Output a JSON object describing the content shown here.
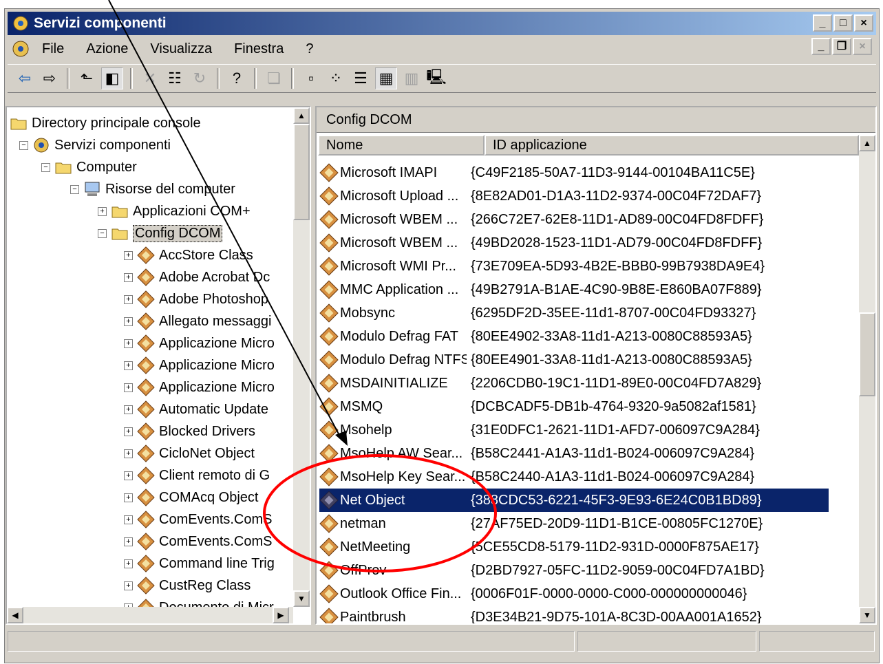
{
  "window": {
    "title": "Servizi componenti"
  },
  "menu": [
    "File",
    "Azione",
    "Visualizza",
    "Finestra",
    "?"
  ],
  "tree": [
    {
      "label": "Directory principale console",
      "icon": "folder-icon",
      "level": 0,
      "expander": ""
    },
    {
      "label": "Servizi componenti",
      "icon": "component-services-icon",
      "level": 1,
      "expander": "−"
    },
    {
      "label": "Computer",
      "icon": "folder-icon",
      "level": 2,
      "expander": "−"
    },
    {
      "label": "Risorse del computer",
      "icon": "computer-icon",
      "level": 3,
      "expander": "−"
    },
    {
      "label": "Applicazioni COM+",
      "icon": "folder-icon",
      "level": 4,
      "expander": "+"
    },
    {
      "label": "Config DCOM",
      "icon": "open-folder-icon",
      "level": 4,
      "expander": "−",
      "selected": true
    },
    {
      "label": "AccStore Class",
      "icon": "component-icon",
      "level": 5,
      "expander": "+"
    },
    {
      "label": "Adobe Acrobat Dc",
      "icon": "component-icon",
      "level": 5,
      "expander": "+"
    },
    {
      "label": "Adobe Photoshop",
      "icon": "component-icon",
      "level": 5,
      "expander": "+"
    },
    {
      "label": "Allegato messaggi",
      "icon": "component-icon",
      "level": 5,
      "expander": "+"
    },
    {
      "label": "Applicazione Micro",
      "icon": "component-icon",
      "level": 5,
      "expander": "+"
    },
    {
      "label": "Applicazione Micro",
      "icon": "component-icon",
      "level": 5,
      "expander": "+"
    },
    {
      "label": "Applicazione Micro",
      "icon": "component-icon",
      "level": 5,
      "expander": "+"
    },
    {
      "label": "Automatic Update",
      "icon": "component-icon",
      "level": 5,
      "expander": "+"
    },
    {
      "label": "Blocked Drivers",
      "icon": "component-icon",
      "level": 5,
      "expander": "+"
    },
    {
      "label": "CicloNet Object",
      "icon": "component-icon",
      "level": 5,
      "expander": "+"
    },
    {
      "label": "Client remoto di G",
      "icon": "component-icon",
      "level": 5,
      "expander": "+"
    },
    {
      "label": "COMAcq Object",
      "icon": "component-icon",
      "level": 5,
      "expander": "+"
    },
    {
      "label": "ComEvents.ComS",
      "icon": "component-icon",
      "level": 5,
      "expander": "+"
    },
    {
      "label": "ComEvents.ComS",
      "icon": "component-icon",
      "level": 5,
      "expander": "+"
    },
    {
      "label": "Command line Trig",
      "icon": "component-icon",
      "level": 5,
      "expander": "+"
    },
    {
      "label": "CustReg Class",
      "icon": "component-icon",
      "level": 5,
      "expander": "+"
    },
    {
      "label": "Documento di Micr",
      "icon": "component-icon",
      "level": 5,
      "expander": "+"
    }
  ],
  "right": {
    "title": "Config DCOM",
    "columns": [
      "Nome",
      "ID applicazione"
    ],
    "rows": [
      {
        "name": "Microsoft IMAPI",
        "id": "{C49F2185-50A7-11D3-9144-00104BA11C5E}"
      },
      {
        "name": "Microsoft Upload ...",
        "id": "{8E82AD01-D1A3-11D2-9374-00C04F72DAF7}"
      },
      {
        "name": "Microsoft WBEM ...",
        "id": "{266C72E7-62E8-11D1-AD89-00C04FD8FDFF}"
      },
      {
        "name": "Microsoft WBEM ...",
        "id": "{49BD2028-1523-11D1-AD79-00C04FD8FDFF}"
      },
      {
        "name": "Microsoft WMI Pr...",
        "id": "{73E709EA-5D93-4B2E-BBB0-99B7938DA9E4}"
      },
      {
        "name": "MMC Application ...",
        "id": "{49B2791A-B1AE-4C90-9B8E-E860BA07F889}"
      },
      {
        "name": "Mobsync",
        "id": "{6295DF2D-35EE-11d1-8707-00C04FD93327}"
      },
      {
        "name": "Modulo Defrag FAT",
        "id": "{80EE4902-33A8-11d1-A213-0080C88593A5}"
      },
      {
        "name": "Modulo Defrag NTFS",
        "id": "{80EE4901-33A8-11d1-A213-0080C88593A5}"
      },
      {
        "name": "MSDAINITIALIZE",
        "id": "{2206CDB0-19C1-11D1-89E0-00C04FD7A829}"
      },
      {
        "name": "MSMQ",
        "id": "{DCBCADF5-DB1b-4764-9320-9a5082af1581}"
      },
      {
        "name": "Msohelp",
        "id": "{31E0DFC1-2621-11D1-AFD7-006097C9A284}"
      },
      {
        "name": "MsoHelp AW Sear...",
        "id": "{B58C2441-A1A3-11d1-B024-006097C9A284}"
      },
      {
        "name": "MsoHelp Key Sear...",
        "id": "{B58C2440-A1A3-11d1-B024-006097C9A284}"
      },
      {
        "name": "Net Object",
        "id": "{388CDC53-6221-45F3-9E93-6E24C0B1BD89}",
        "selected": true
      },
      {
        "name": "netman",
        "id": "{27AF75ED-20D9-11D1-B1CE-00805FC1270E}"
      },
      {
        "name": "NetMeeting",
        "id": "{5CE55CD8-5179-11D2-931D-0000F875AE17}"
      },
      {
        "name": "OffProv",
        "id": "{D2BD7927-05FC-11D2-9059-00C04FD7A1BD}"
      },
      {
        "name": "Outlook Office Fin...",
        "id": "{0006F01F-0000-0000-C000-000000000046}"
      },
      {
        "name": "Paintbrush",
        "id": "{D3E34B21-9D75-101A-8C3D-00AA001A1652}"
      }
    ]
  },
  "colors": {
    "title_active": "#0a246a",
    "selection": "#0a246a",
    "annotation_circle": "#ff0000",
    "annotation_arrow": "#000000"
  }
}
